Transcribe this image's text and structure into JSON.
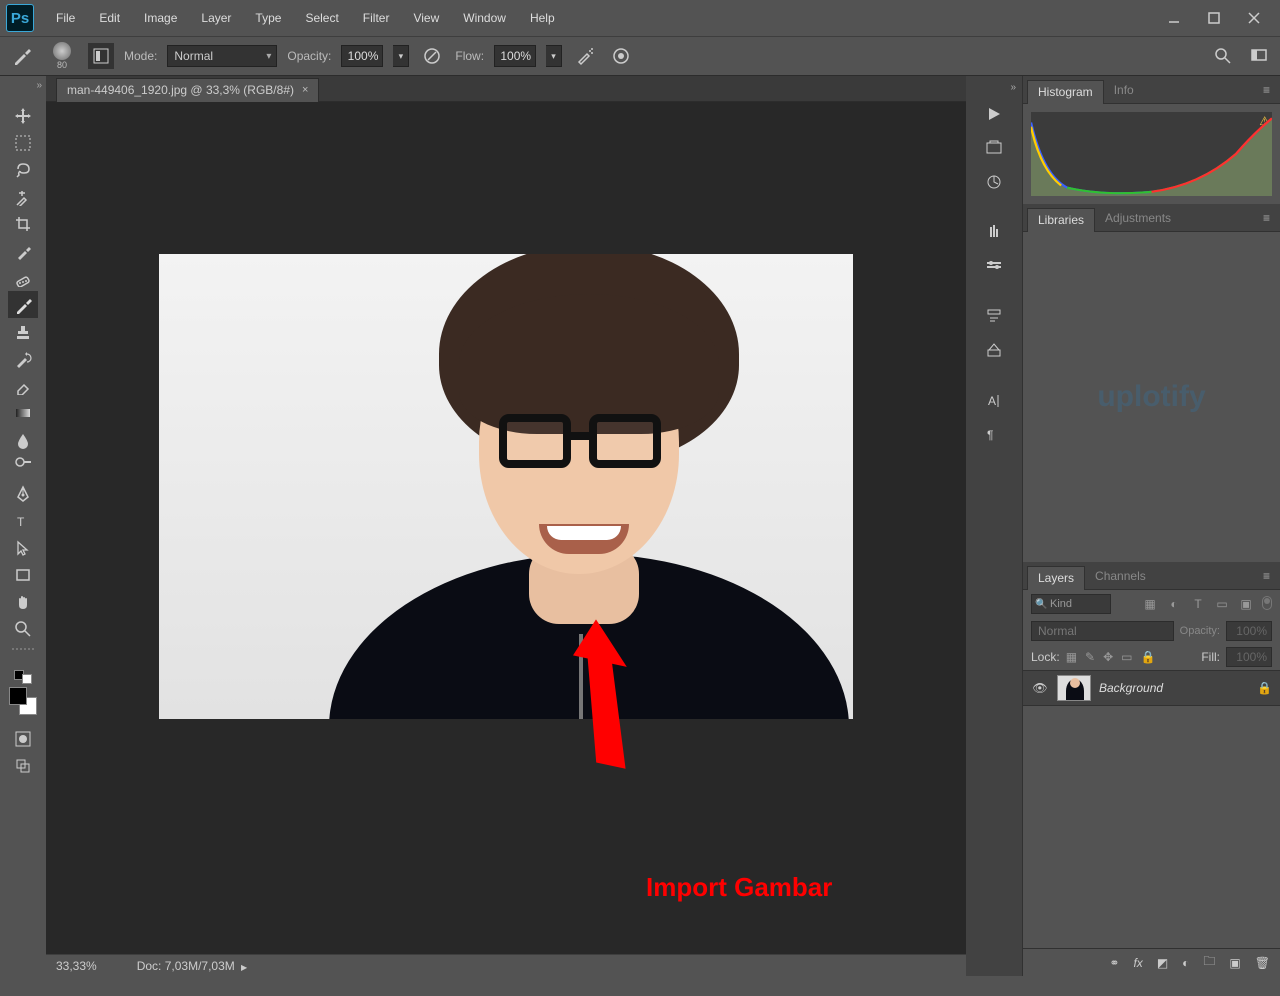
{
  "menu": {
    "items": [
      "File",
      "Edit",
      "Image",
      "Layer",
      "Type",
      "Select",
      "Filter",
      "View",
      "Window",
      "Help"
    ]
  },
  "options_bar": {
    "brush_size": "80",
    "mode_label": "Mode:",
    "mode_value": "Normal",
    "opacity_label": "Opacity:",
    "opacity_value": "100%",
    "flow_label": "Flow:",
    "flow_value": "100%"
  },
  "document": {
    "tab_title": "man-449406_1920.jpg @ 33,3% (RGB/8#)",
    "zoom": "33,33%",
    "doc_info": "Doc: 7,03M/7,03M"
  },
  "annotation": {
    "label": "Import Gambar"
  },
  "panels": {
    "histogram": {
      "tabs": [
        "Histogram",
        "Info"
      ],
      "active": 0
    },
    "libraries": {
      "tabs": [
        "Libraries",
        "Adjustments"
      ],
      "active": 0,
      "watermark": "uplotify"
    },
    "layers": {
      "tabs": [
        "Layers",
        "Channels"
      ],
      "active": 0,
      "filter_kind": "Kind",
      "blend_mode": "Normal",
      "opacity_label": "Opacity:",
      "opacity_value": "100%",
      "lock_label": "Lock:",
      "fill_label": "Fill:",
      "fill_value": "100%",
      "layer_items": [
        {
          "name": "Background",
          "locked": true
        }
      ]
    }
  }
}
